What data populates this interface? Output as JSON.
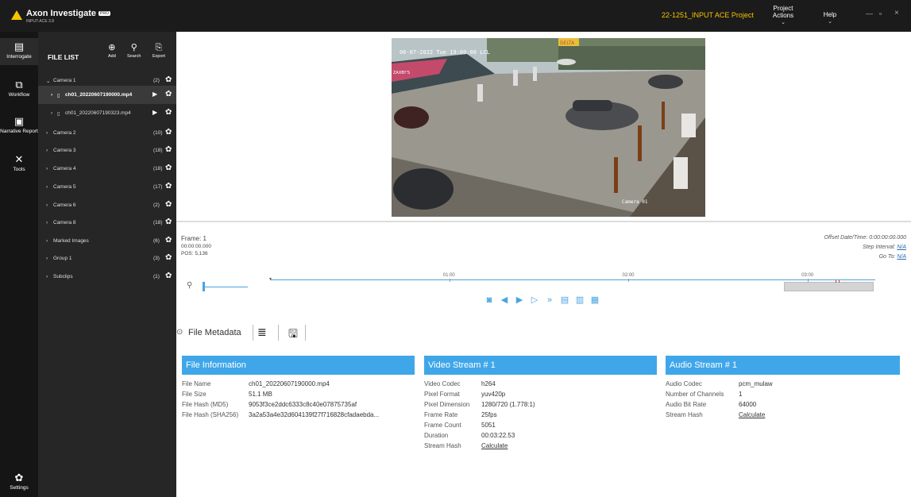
{
  "app": {
    "name": "Axon Investigate",
    "badge": "PRO",
    "version": "INPUT-ACE 3.8",
    "project": "22-1251_INPUT ACE Project",
    "menu": [
      {
        "label": "Project Actions"
      },
      {
        "label": "Help"
      }
    ]
  },
  "rail": [
    {
      "label": "Interrogate",
      "icon": "file-icon"
    },
    {
      "label": "Workflow",
      "icon": "workflow-icon"
    },
    {
      "label": "Narrative Report",
      "icon": "report-icon"
    },
    {
      "label": "Tools",
      "icon": "tools-icon"
    },
    {
      "label": "Settings",
      "icon": "gear-icon"
    }
  ],
  "filelist": {
    "title": "FILE LIST",
    "tools": [
      {
        "label": "Add",
        "icon": "add-icon"
      },
      {
        "label": "Search",
        "icon": "search-icon"
      },
      {
        "label": "Export",
        "icon": "export-icon"
      }
    ],
    "items": [
      {
        "label": "Camera 1",
        "count": "(2)",
        "expanded": true
      },
      {
        "label": "ch01_20220607190000.mp4",
        "selected": true
      },
      {
        "label": "ch01_20220607190323.mp4"
      },
      {
        "label": "Camera 2",
        "count": "(10)"
      },
      {
        "label": "Camera 3",
        "count": "(18)"
      },
      {
        "label": "Camera 4",
        "count": "(18)"
      },
      {
        "label": "Camera 5",
        "count": "(17)"
      },
      {
        "label": "Camera 6",
        "count": "(2)"
      },
      {
        "label": "Camera 8",
        "count": "(18)"
      },
      {
        "label": "Marked Images",
        "count": "(6)"
      },
      {
        "label": "Group 1",
        "count": "(3)"
      },
      {
        "label": "Subclips",
        "count": "(1)"
      }
    ]
  },
  "video": {
    "overlay_timestamp": "06-07-2022 Tue 19:00:00 LCL",
    "overlay_camera": "Camera 01",
    "overlay_sign": "ZAXBY'S",
    "overlay_canopy": "DELTA"
  },
  "timeline": {
    "frame": "Frame: 1",
    "time": "00:00:00.000",
    "pos": "POS: 5,136",
    "offset_label": "Offset Date/Time:",
    "offset_value": "0:00:00:00.000",
    "step_label": "Step Interval:",
    "step_value": "N/A",
    "goto_label": "Go To:",
    "goto_value": "N/A",
    "ticks": [
      "01:00",
      "02:00",
      "03:00"
    ],
    "total_duration_s": 202.53,
    "tick_seconds": [
      60,
      120,
      180
    ]
  },
  "metadata": {
    "tab_label": "File Metadata",
    "file_info": {
      "title": "File Information",
      "rows": [
        {
          "k": "File Name",
          "v": "ch01_20220607190000.mp4"
        },
        {
          "k": "File Size",
          "v": "51.1 MB"
        },
        {
          "k": "File Hash (MD5)",
          "v": "9053f3ce2ddc6333c8c40e07875735af"
        },
        {
          "k": "File Hash (SHA256)",
          "v": "3a2a53a4e32d604139f27f716828cfadaebda..."
        }
      ]
    },
    "video_stream": {
      "title": "Video Stream # 1",
      "rows": [
        {
          "k": "Video Codec",
          "v": "h264"
        },
        {
          "k": "Pixel Format",
          "v": "yuv420p"
        },
        {
          "k": "Pixel Dimension",
          "v": "1280/720 (1.778:1)"
        },
        {
          "k": "Frame Rate",
          "v": "25fps"
        },
        {
          "k": "Frame Count",
          "v": "5051"
        },
        {
          "k": "Duration",
          "v": "00:03:22.53"
        },
        {
          "k": "Stream Hash",
          "v": "Calculate"
        }
      ]
    },
    "audio_stream": {
      "title": "Audio Stream # 1",
      "rows": [
        {
          "k": "Audio Codec",
          "v": "pcm_mulaw"
        },
        {
          "k": "Number of Channels",
          "v": "1"
        },
        {
          "k": "Audio Bit Rate",
          "v": "64000"
        },
        {
          "k": "Stream Hash",
          "v": "Calculate"
        }
      ]
    }
  },
  "colors": {
    "accent": "#3fa7e9",
    "brand": "#f5c400",
    "titlebar": "#1b1b1b",
    "panel": "#262626"
  }
}
